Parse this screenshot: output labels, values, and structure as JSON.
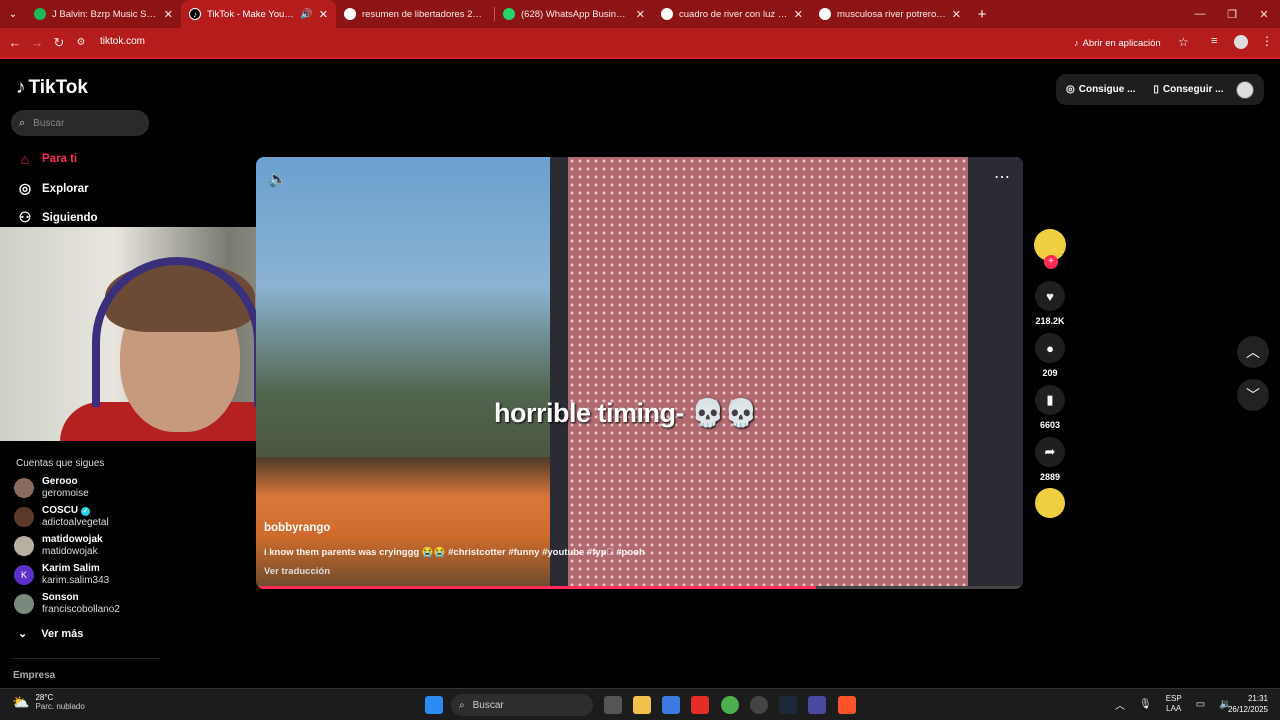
{
  "browser": {
    "tabs": [
      {
        "title": "J Balvin: Bzrp Music Sessions, Vo",
        "icon": "spotify-icon",
        "color": "#1db954",
        "active": false
      },
      {
        "title": "TikTok - Make Your Day",
        "icon": "tiktok-icon",
        "color": "#000000",
        "active": true
      },
      {
        "title": "resumen de libertadores 2018 (",
        "icon": "google-icon",
        "color": "#ffffff",
        "active": false
      },
      {
        "title": "(628) WhatsApp Business",
        "icon": "whatsapp-icon",
        "color": "#25d366",
        "active": false
      },
      {
        "title": "cuadro de river con luz - Busca",
        "icon": "google-icon",
        "color": "#ffffff",
        "active": false
      },
      {
        "title": "musculosa river potrero - Busca",
        "icon": "google-icon",
        "color": "#ffffff",
        "active": false
      }
    ],
    "new_tab": "+",
    "url": "tiktok.com",
    "open_in_app": "Abrir en aplicación",
    "accent": "#b51c1c"
  },
  "tiktok": {
    "logo": "TikTok",
    "search_placeholder": "Buscar",
    "nav": [
      {
        "label": "Para ti",
        "icon": "home-icon",
        "active": true
      },
      {
        "label": "Explorar",
        "icon": "compass-icon",
        "active": false
      },
      {
        "label": "Siguiendo",
        "icon": "person-icon",
        "active": false
      }
    ],
    "following_header": "Cuentas que sigues",
    "accounts": [
      {
        "name": "Gerooo",
        "handle": "geromoise",
        "initial": ""
      },
      {
        "name": "COSCU",
        "handle": "adictoalvegetal",
        "initial": "",
        "verified": true
      },
      {
        "name": "matidowojak",
        "handle": "matidowojak",
        "initial": ""
      },
      {
        "name": "Karim Salim",
        "handle": "karim.salim343",
        "initial": "K"
      },
      {
        "name": "Sonson",
        "handle": "franciscobollano2",
        "initial": ""
      }
    ],
    "see_more": "Ver más",
    "company": "Empresa",
    "top_right": {
      "get_coins": "Consigue ...",
      "get_app": "Conseguir ..."
    },
    "video": {
      "caption": "horrible timing- 💀💀",
      "author": "bobbyrango",
      "description": "i know them parents was cryinggg 😭😭 #christcotter #funny #youtube #fyp゚ #pooh",
      "translate": "Ver traducción",
      "progress": 0.73
    },
    "actions": {
      "likes": "218.2K",
      "comments": "209",
      "saves": "6603",
      "shares": "2889"
    },
    "brand_color": "#fe2c55"
  },
  "taskbar": {
    "temperature": "28°C",
    "weather": "Parc. nublado",
    "search_placeholder": "Buscar",
    "language": "ESP",
    "layout": "LAA",
    "time": "21:31",
    "date": "26/12/2025"
  }
}
